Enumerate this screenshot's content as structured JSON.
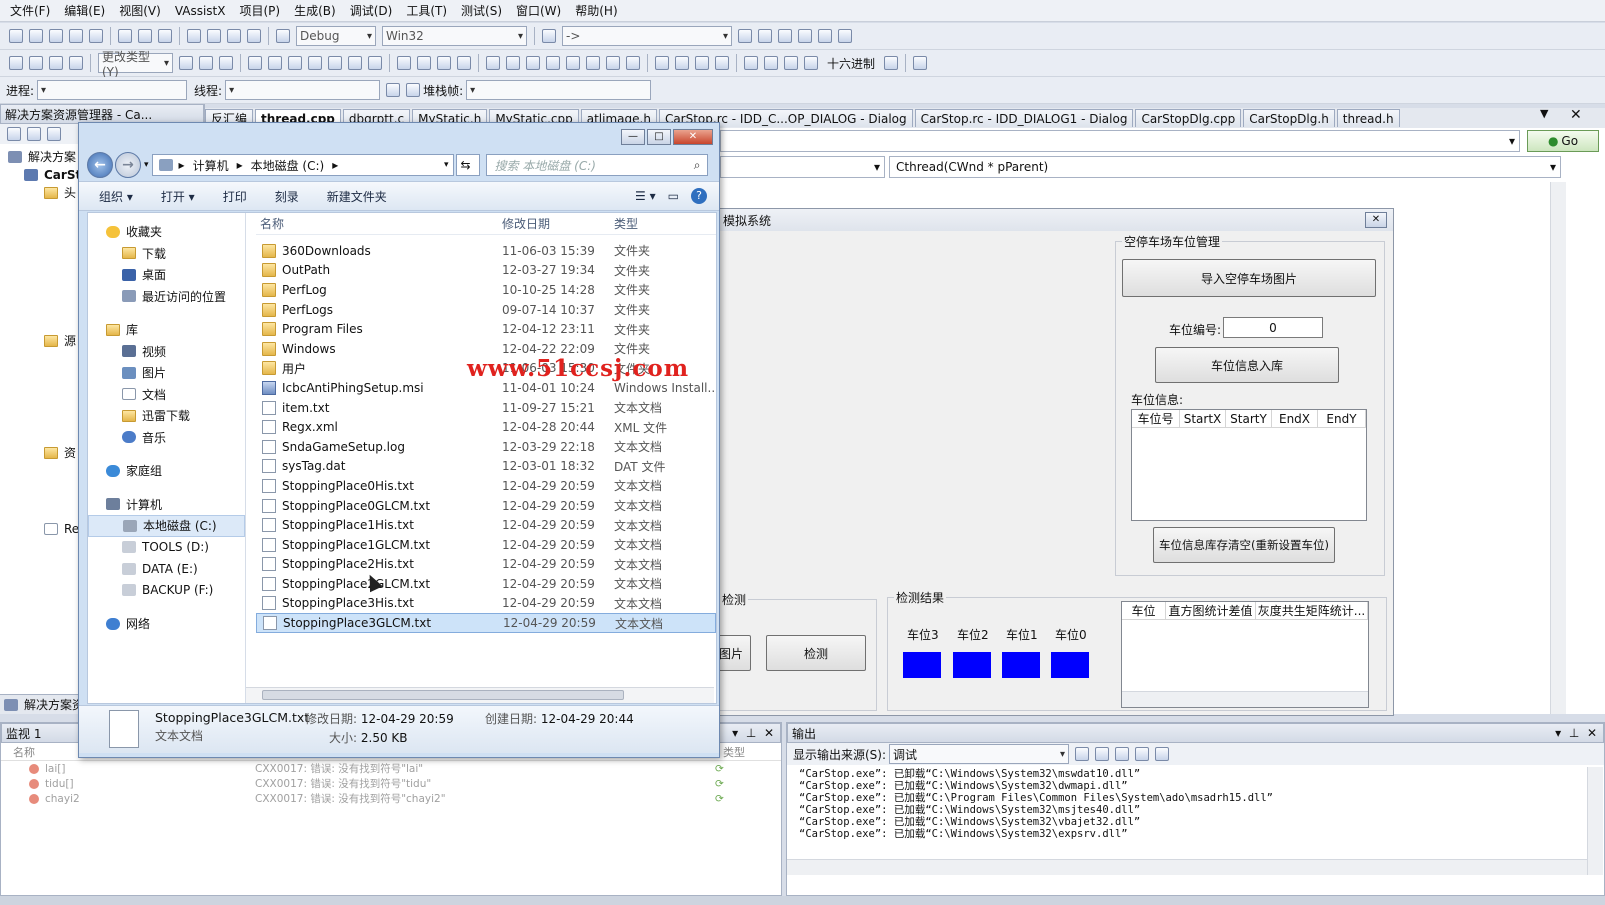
{
  "menu": [
    "文件(F)",
    "编辑(E)",
    "视图(V)",
    "VAssistX",
    "项目(P)",
    "生成(B)",
    "调试(D)",
    "工具(T)",
    "测试(S)",
    "窗口(W)",
    "帮助(H)"
  ],
  "toolbar": {
    "config": "Debug",
    "platform": "Win32",
    "arrow": "->",
    "change_type": "更改类型(Y)",
    "hex": "十六进制",
    "process_label": "进程:",
    "thread_label": "线程:",
    "stack_label": "堆栈帧:"
  },
  "solution_explorer": {
    "title": "解决方案资源管理器 - Ca...",
    "root": "解决方案",
    "project": "CarSt",
    "items": [
      "头",
      "源",
      "资",
      "Re"
    ],
    "bottom_tab": "解决方案资"
  },
  "editor": {
    "tabs": [
      "反汇编",
      "thread.cpp",
      "dbgrptt.c",
      "MyStatic.h",
      "MyStatic.cpp",
      "atlimage.h",
      "CarStop.rc - IDD_C...OP_DIALOG - Dialog",
      "CarStop.rc - IDD_DIALOG1 - Dialog",
      "CarStopDlg.cpp",
      "CarStopDlg.h",
      "thread.h"
    ],
    "active_tab": "thread.cpp",
    "go": "Go",
    "function": "Cthread(CWnd * pParent)"
  },
  "explorer": {
    "address": [
      "计算机",
      "本地磁盘 (C:)"
    ],
    "search_placeholder": "搜索 本地磁盘 (C:)",
    "commands": [
      "组织 ▾",
      "打开 ▾",
      "打印",
      "刻录",
      "新建文件夹"
    ],
    "nav": {
      "favorites": "收藏夹",
      "fav_items": [
        "下载",
        "桌面",
        "最近访问的位置"
      ],
      "libraries": "库",
      "lib_items": [
        "视频",
        "图片",
        "文档",
        "迅雷下载",
        "音乐"
      ],
      "homegroup": "家庭组",
      "computer": "计算机",
      "drives": [
        "本地磁盘 (C:)",
        "TOOLS (D:)",
        "DATA (E:)",
        "BACKUP (F:)"
      ],
      "network": "网络"
    },
    "columns": [
      "名称",
      "修改日期",
      "类型"
    ],
    "files": [
      {
        "name": "360Downloads",
        "date": "11-06-03 15:39",
        "type": "文件夹",
        "icon": "folder"
      },
      {
        "name": "OutPath",
        "date": "12-03-27 19:34",
        "type": "文件夹",
        "icon": "folder"
      },
      {
        "name": "PerfLog",
        "date": "10-10-25 14:28",
        "type": "文件夹",
        "icon": "folder"
      },
      {
        "name": "PerfLogs",
        "date": "09-07-14 10:37",
        "type": "文件夹",
        "icon": "folder"
      },
      {
        "name": "Program Files",
        "date": "12-04-12 23:11",
        "type": "文件夹",
        "icon": "folder"
      },
      {
        "name": "Windows",
        "date": "12-04-22 22:09",
        "type": "文件夹",
        "icon": "folder"
      },
      {
        "name": "用户",
        "date": "11-06-03 15:30",
        "type": "文件夹",
        "icon": "folder"
      },
      {
        "name": "IcbcAntiPhingSetup.msi",
        "date": "11-04-01 10:24",
        "type": "Windows Install...",
        "icon": "msi"
      },
      {
        "name": "item.txt",
        "date": "11-09-27 15:21",
        "type": "文本文档",
        "icon": "doc"
      },
      {
        "name": "Regx.xml",
        "date": "12-04-28 20:44",
        "type": "XML 文件",
        "icon": "doc"
      },
      {
        "name": "SndaGameSetup.log",
        "date": "12-03-29 22:18",
        "type": "文本文档",
        "icon": "doc"
      },
      {
        "name": "sysTag.dat",
        "date": "12-03-01 18:32",
        "type": "DAT 文件",
        "icon": "doc"
      },
      {
        "name": "StoppingPlace0His.txt",
        "date": "12-04-29 20:59",
        "type": "文本文档",
        "icon": "doc"
      },
      {
        "name": "StoppingPlace0GLCM.txt",
        "date": "12-04-29 20:59",
        "type": "文本文档",
        "icon": "doc"
      },
      {
        "name": "StoppingPlace1His.txt",
        "date": "12-04-29 20:59",
        "type": "文本文档",
        "icon": "doc"
      },
      {
        "name": "StoppingPlace1GLCM.txt",
        "date": "12-04-29 20:59",
        "type": "文本文档",
        "icon": "doc"
      },
      {
        "name": "StoppingPlace2His.txt",
        "date": "12-04-29 20:59",
        "type": "文本文档",
        "icon": "doc"
      },
      {
        "name": "StoppingPlace2GLCM.txt",
        "date": "12-04-29 20:59",
        "type": "文本文档",
        "icon": "doc"
      },
      {
        "name": "StoppingPlace3His.txt",
        "date": "12-04-29 20:59",
        "type": "文本文档",
        "icon": "doc"
      },
      {
        "name": "StoppingPlace3GLCM.txt",
        "date": "12-04-29 20:59",
        "type": "文本文档",
        "icon": "doc"
      }
    ],
    "details": {
      "name": "StoppingPlace3GLCM.txt",
      "type": "文本文档",
      "modified_label": "修改日期:",
      "modified": "12-04-29 20:59",
      "created_label": "创建日期:",
      "created": "12-04-29 20:44",
      "size_label": "大小:",
      "size": "2.50 KB"
    }
  },
  "dialog": {
    "title": "模拟系统",
    "mgmt_group": "空停车场车位管理",
    "import_button": "导入空停车场图片",
    "slot_label": "车位编号:",
    "slot_value": "0",
    "save_button": "车位信息入库",
    "info_label": "车位信息:",
    "info_columns": [
      "车位号",
      "StartX",
      "StartY",
      "EndX",
      "EndY"
    ],
    "clear_button": "车位信息库存清空(重新设置车位)",
    "detect_group": "检测",
    "image_button": "图片",
    "detect_button": "检测",
    "result_group": "检测结果",
    "slots": [
      "车位3",
      "车位2",
      "车位1",
      "车位0"
    ],
    "result_columns": [
      "车位",
      "直方图统计差值",
      "灰度共生矩阵统计..."
    ]
  },
  "watch": {
    "title": "监视 1",
    "col_name": "名称",
    "col_type": "类型",
    "rows": [
      {
        "name": "lai[]",
        "value": "CXX0017: 错误: 没有找到符号\"lai\""
      },
      {
        "name": "tidu[]",
        "value": "CXX0017: 错误: 没有找到符号\"tidu\""
      },
      {
        "name": "chayi2",
        "value": "CXX0017: 错误: 没有找到符号\"chayi2\""
      }
    ]
  },
  "output": {
    "title": "输出",
    "source_label": "显示输出来源(S):",
    "source": "调试",
    "lines": [
      "“CarStop.exe”: 已卸载“C:\\Windows\\System32\\mswdat10.dll”",
      "“CarStop.exe”: 已加载“C:\\Windows\\System32\\dwmapi.dll”",
      "“CarStop.exe”: 已加载“C:\\Program Files\\Common Files\\System\\ado\\msadrh15.dll”",
      "“CarStop.exe”: 已加载“C:\\Windows\\System32\\msjtes40.dll”",
      "“CarStop.exe”: 已加载“C:\\Windows\\System32\\vbajet32.dll”",
      "“CarStop.exe”: 已加载“C:\\Windows\\System32\\expsrv.dll”"
    ]
  },
  "watermark": "www.51ccsj.com",
  "colors": {
    "slot_blue": "#0000ff",
    "watermark": "#e0221e",
    "selection": "#cde3f9"
  }
}
